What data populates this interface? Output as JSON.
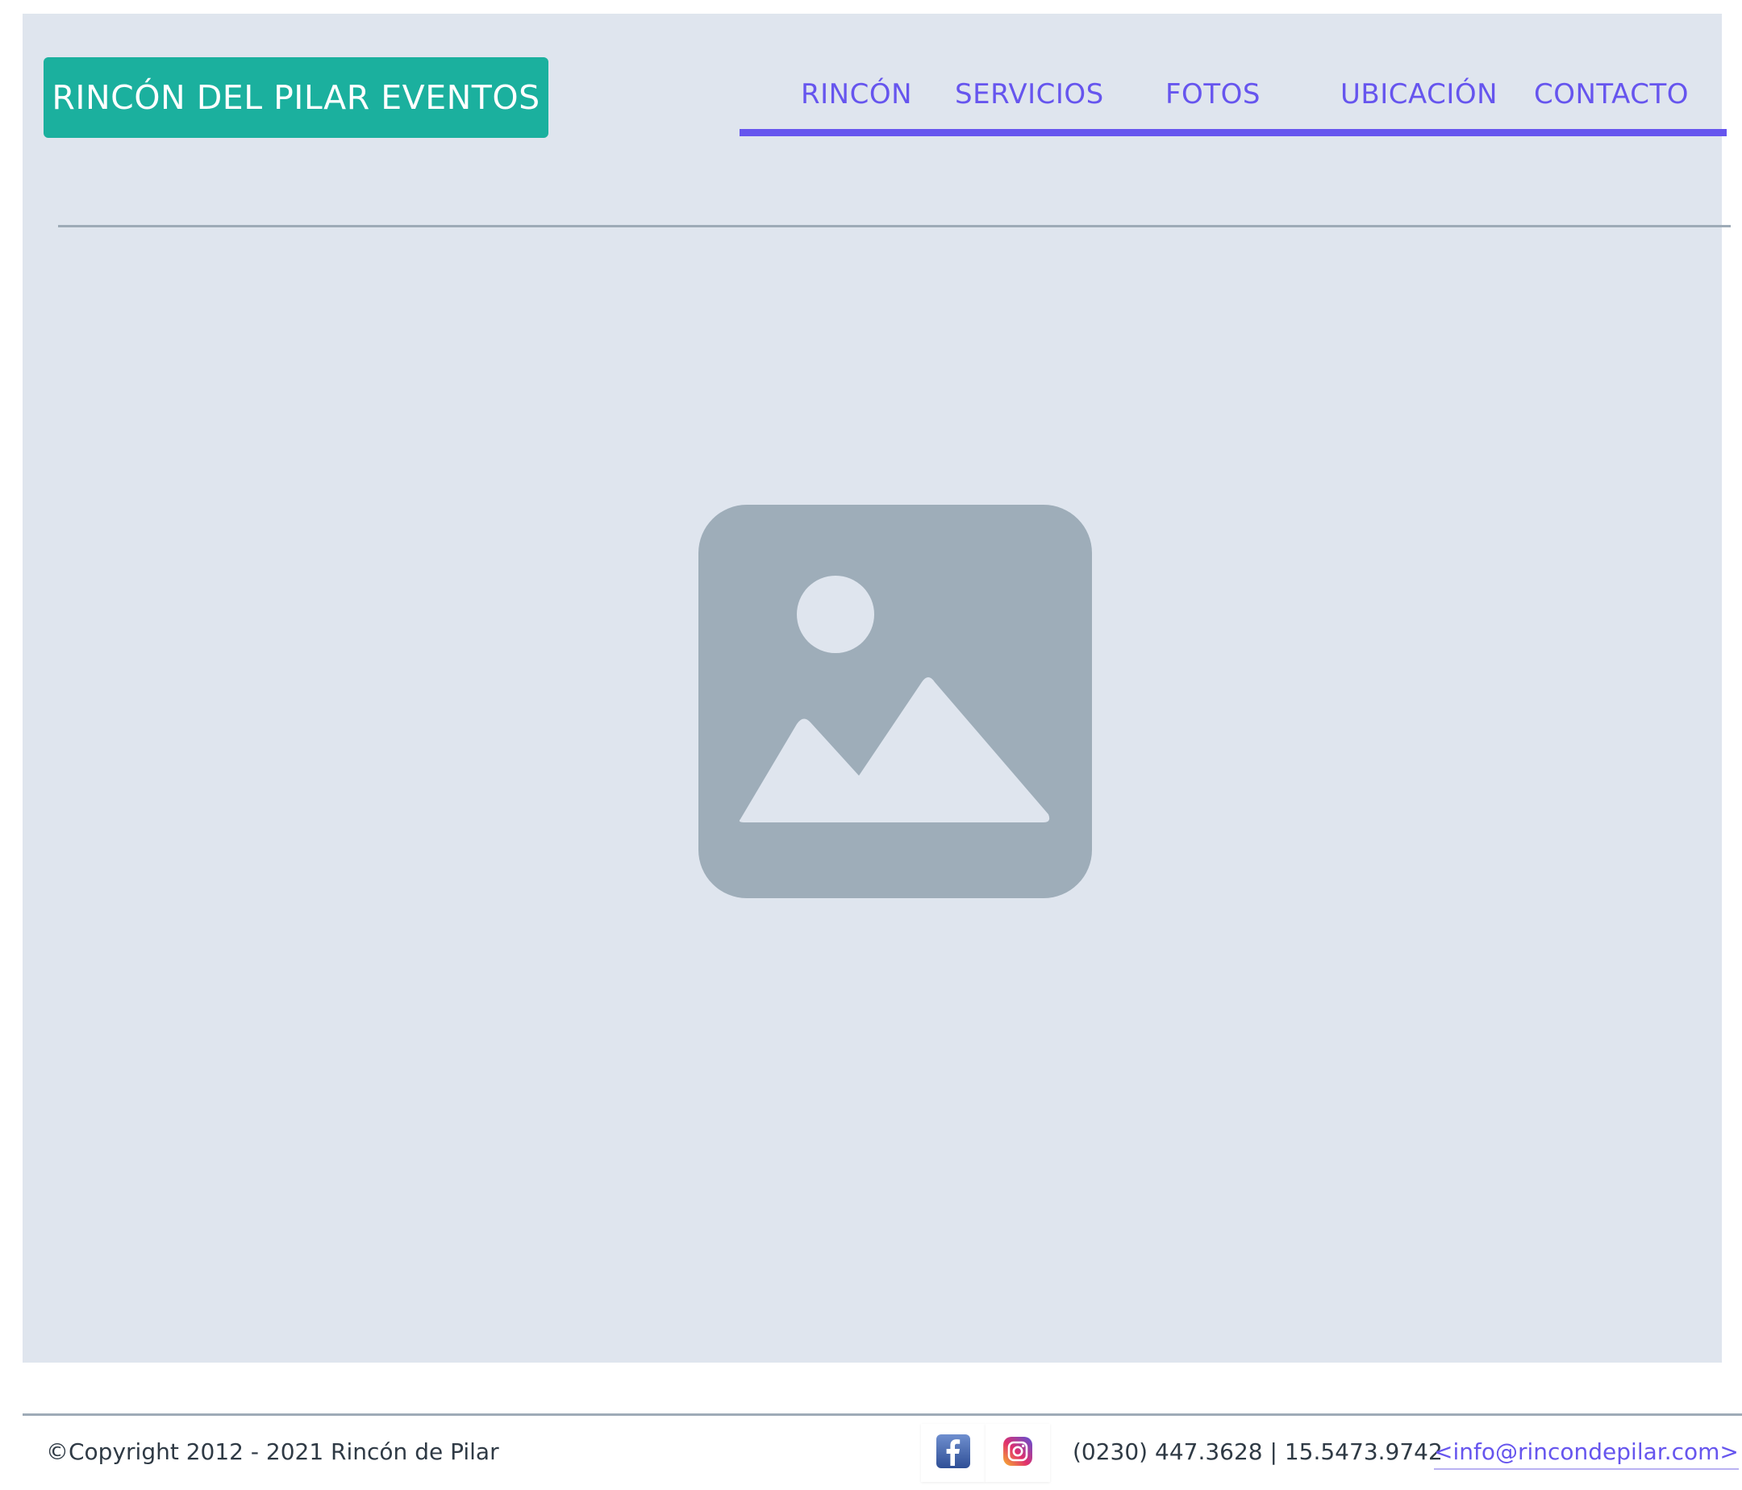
{
  "brand": {
    "title": "RINCÓN DEL PILAR EVENTOS",
    "color": "#1bb09e"
  },
  "nav": {
    "accent_color": "#6655ee",
    "items": [
      {
        "label": "RINCÓN"
      },
      {
        "label": "SERVICIOS"
      },
      {
        "label": "FOTOS"
      },
      {
        "label": "UBICACIÓN"
      },
      {
        "label": "CONTACTO"
      }
    ]
  },
  "hero": {
    "image_icon": "image-placeholder-icon",
    "background": "#dfe5ee"
  },
  "footer": {
    "copyright": "©Copyright 2012 - 2021 Rincón de Pilar",
    "social": [
      {
        "icon": "facebook-icon"
      },
      {
        "icon": "instagram-icon"
      }
    ],
    "phone": "(0230) 447.3628 | 15.5473.9742",
    "email": "<info@rincondepilar.com>"
  }
}
